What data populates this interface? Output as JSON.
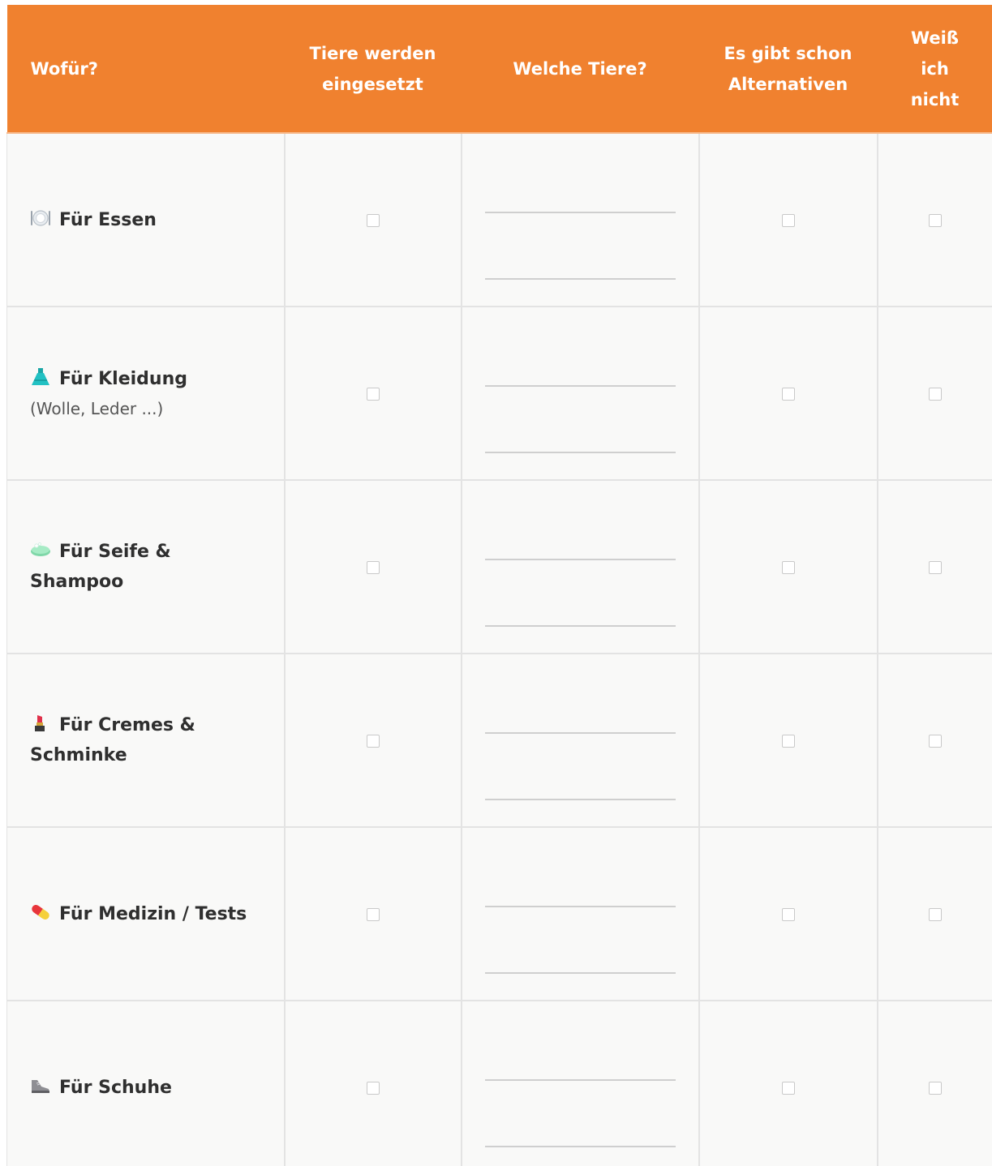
{
  "header": {
    "col_purpose": "Wofür?",
    "col_used": "Tiere werden eingesetzt",
    "col_which": "Welche Tiere?",
    "col_alternatives": "Es gibt schon Alternativen",
    "col_unknown": "Weiß ich nicht"
  },
  "rows": [
    {
      "icon": "plate-cutlery-icon",
      "label": "Für Essen",
      "sub": ""
    },
    {
      "icon": "dress-icon",
      "label": "Für Kleidung",
      "sub": "(Wolle, Leder ...)"
    },
    {
      "icon": "soap-icon",
      "label": "Für Seife & Shampoo",
      "sub": ""
    },
    {
      "icon": "lipstick-icon",
      "label": "Für Cremes & Schminke",
      "sub": ""
    },
    {
      "icon": "pill-icon",
      "label": "Für Medizin / Tests",
      "sub": ""
    },
    {
      "icon": "shoe-icon",
      "label": "Für Schuhe",
      "sub": ""
    }
  ],
  "colors": {
    "header_bg": "#f0812f",
    "header_text": "#ffffff",
    "cell_bg": "#f9f9f8",
    "grid": "#e3e3e3"
  }
}
